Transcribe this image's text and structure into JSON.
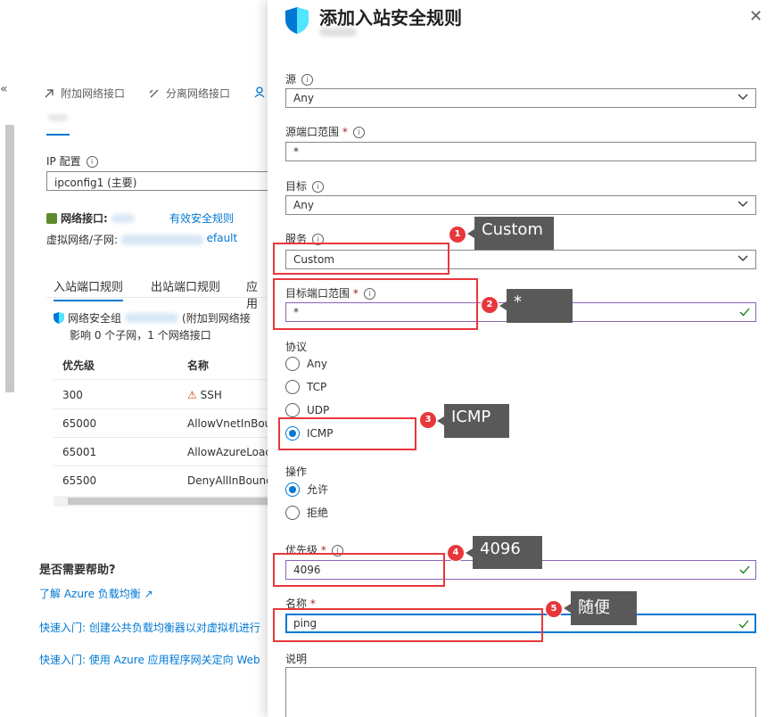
{
  "left": {
    "collapse": "«",
    "toolbar": [
      {
        "label": "附加网络接口",
        "icon": "attach-icon"
      },
      {
        "label": "分离网络接口",
        "icon": "detach-icon"
      }
    ],
    "ip_config_label": "IP 配置",
    "ip_config_value": "ipconfig1 (主要)",
    "nic_label": "网络接口:",
    "effective_rules_link": "有效安全规则",
    "vnet_label": "虚拟网络/子网:",
    "vnet_default": "default",
    "tabs": [
      "入站端口规则",
      "出站端口规则",
      "应用"
    ],
    "nsg_text": "网络安全组",
    "nsg_attached": "(附加到网络接",
    "affect_text": "影响 0 个子网，1 个网络接口",
    "table": {
      "headers": [
        "优先级",
        "名称"
      ],
      "rows": [
        {
          "priority": "300",
          "name": "SSH",
          "warn": true
        },
        {
          "priority": "65000",
          "name": "AllowVnetInBou",
          "warn": false
        },
        {
          "priority": "65001",
          "name": "AllowAzureLoad",
          "warn": false
        },
        {
          "priority": "65500",
          "name": "DenyAllInBound",
          "warn": false
        }
      ]
    },
    "help_title": "是否需要帮助?",
    "help_links": [
      "了解 Azure 负载均衡 ↗",
      "快速入门: 创建公共负载均衡器以对虚拟机进行",
      "快速入门: 使用 Azure 应用程序网关定向 Web"
    ]
  },
  "panel": {
    "title": "添加入站安全规则",
    "close": "✕",
    "source_label": "源",
    "source_value": "Any",
    "source_port_label": "源端口范围",
    "source_port_value": "*",
    "dest_label": "目标",
    "dest_value": "Any",
    "service_label": "服务",
    "service_value": "Custom",
    "dest_port_label": "目标端口范围",
    "dest_port_value": "*",
    "protocol_label": "协议",
    "protocols": [
      "Any",
      "TCP",
      "UDP",
      "ICMP"
    ],
    "protocol_selected": "ICMP",
    "action_label": "操作",
    "actions": [
      "允许",
      "拒绝"
    ],
    "priority_label": "优先级",
    "priority_value": "4096",
    "name_label": "名称",
    "name_value": "ping",
    "desc_label": "说明",
    "required_mark": "*",
    "info_glyph": "i"
  },
  "annotations": [
    {
      "num": "1",
      "text": "Custom"
    },
    {
      "num": "2",
      "text": "*"
    },
    {
      "num": "3",
      "text": "ICMP"
    },
    {
      "num": "4",
      "text": "4096"
    },
    {
      "num": "5",
      "text": "随便"
    }
  ],
  "colors": {
    "accent": "#0078d4",
    "highlight": "#e8373b",
    "callout": "#595959"
  }
}
